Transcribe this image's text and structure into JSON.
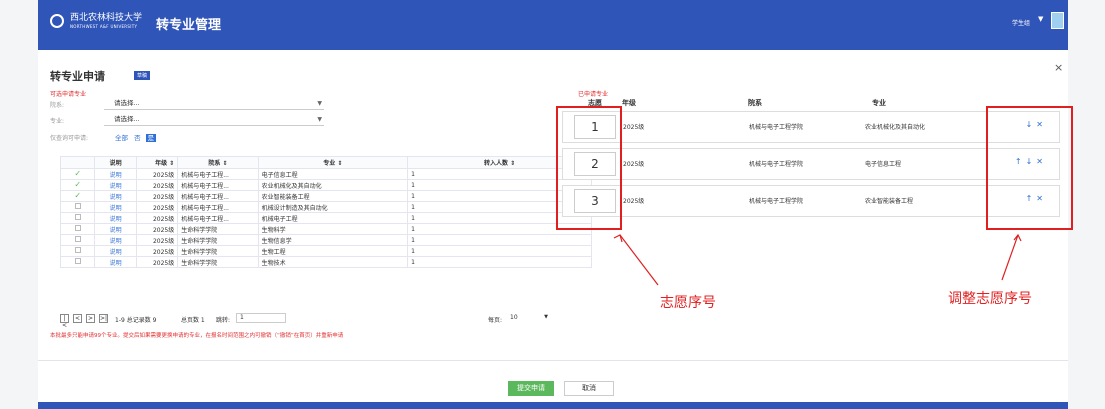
{
  "header": {
    "university_cn": "西北农林科技大学",
    "university_en": "NORTHWEST A&F UNIVERSITY",
    "app_title": "转专业管理",
    "user_role": "学生组"
  },
  "dialog": {
    "title": "转专业申请",
    "status_tag": "草稿",
    "close_icon": "×"
  },
  "available": {
    "section_title": "可选申请专业",
    "dept_label": "院系:",
    "dept_placeholder": "请选择...",
    "major_label": "专业:",
    "major_placeholder": "请选择...",
    "filter_label": "仅查询可申请:",
    "filter_all": "全部",
    "filter_no": "否",
    "filter_yes": "是"
  },
  "table": {
    "columns": [
      "说明",
      "年级",
      "院系",
      "专业",
      "转入人数"
    ],
    "rows": [
      {
        "checked": true,
        "note": "说明",
        "grade": "2025级",
        "dept": "机械与电子工程...",
        "major": "电子信息工程",
        "count": "1"
      },
      {
        "checked": true,
        "note": "说明",
        "grade": "2025级",
        "dept": "机械与电子工程...",
        "major": "农业机械化及其自动化",
        "count": "1"
      },
      {
        "checked": true,
        "note": "说明",
        "grade": "2025级",
        "dept": "机械与电子工程...",
        "major": "农业智能装备工程",
        "count": "1"
      },
      {
        "checked": false,
        "note": "说明",
        "grade": "2025级",
        "dept": "机械与电子工程...",
        "major": "机械设计制造及其自动化",
        "count": "1"
      },
      {
        "checked": false,
        "note": "说明",
        "grade": "2025级",
        "dept": "机械与电子工程...",
        "major": "机械电子工程",
        "count": "1"
      },
      {
        "checked": false,
        "note": "说明",
        "grade": "2025级",
        "dept": "生命科学学院",
        "major": "生物科学",
        "count": "1"
      },
      {
        "checked": false,
        "note": "说明",
        "grade": "2025级",
        "dept": "生命科学学院",
        "major": "生物信息学",
        "count": "1"
      },
      {
        "checked": false,
        "note": "说明",
        "grade": "2025级",
        "dept": "生命科学学院",
        "major": "生物工程",
        "count": "1"
      },
      {
        "checked": false,
        "note": "说明",
        "grade": "2025级",
        "dept": "生命科学学院",
        "major": "生物技术",
        "count": "1"
      }
    ]
  },
  "pager": {
    "first": "|<",
    "prev": "<",
    "next": ">",
    "last": ">|",
    "range_info": "1-9 总记录数 9",
    "total_pages": "总页数 1",
    "jump_label": "跳转:",
    "jump_value": "1",
    "page_size_label": "每页:",
    "page_size_value": "10"
  },
  "notice": "本批最多只能申请99个专业。提交后如果需要更换申请的专业，在报名时间范围之内可撤销（“撤销”在首页）并重新申请",
  "applied": {
    "section_title": "已申请专业",
    "col_priority": "志愿",
    "col_grade": "年级",
    "col_dept": "院系",
    "col_major": "专业",
    "rows": [
      {
        "priority": "1",
        "grade": "2025级",
        "dept": "机械与电子工程学院",
        "major": "农业机械化及其自动化",
        "actions": [
          "down-arrow",
          "remove"
        ]
      },
      {
        "priority": "2",
        "grade": "2025级",
        "dept": "机械与电子工程学院",
        "major": "电子信息工程",
        "actions": [
          "up-arrow",
          "down-arrow",
          "remove"
        ]
      },
      {
        "priority": "3",
        "grade": "2025级",
        "dept": "机械与电子工程学院",
        "major": "农业智能装备工程",
        "actions": [
          "up-arrow",
          "remove"
        ]
      }
    ]
  },
  "annotations": {
    "priority_label": "志愿序号",
    "adjust_label": "调整志愿序号",
    "color": "#e02020"
  },
  "footer": {
    "submit": "提交申请",
    "cancel": "取消"
  },
  "colors": {
    "brand": "#2f55b8",
    "link": "#2f6fd6",
    "submit": "#5cb85c",
    "alert": "#e23030"
  }
}
